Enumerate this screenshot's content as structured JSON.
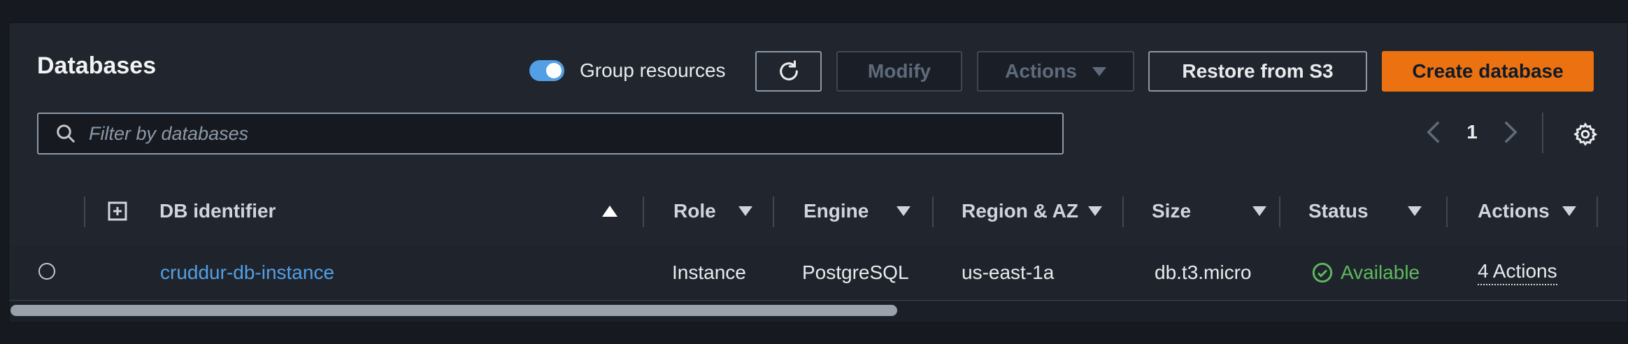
{
  "title": "Databases",
  "toggle": {
    "label": "Group resources",
    "on": true
  },
  "buttons": {
    "modify": "Modify",
    "actions": "Actions",
    "restore": "Restore from S3",
    "create": "Create database"
  },
  "search": {
    "placeholder": "Filter by databases"
  },
  "pagination": {
    "page": "1"
  },
  "table": {
    "columns": [
      "DB identifier",
      "Role",
      "Engine",
      "Region & AZ",
      "Size",
      "Status",
      "Actions"
    ],
    "rows": [
      {
        "db_identifier": "cruddur-db-instance",
        "role": "Instance",
        "engine": "PostgreSQL",
        "region_az": "us-east-1a",
        "size": "db.t3.micro",
        "status": "Available",
        "actions": "4 Actions"
      }
    ]
  },
  "colors": {
    "primary": "#ec7211",
    "link": "#539fe5",
    "status_ok": "#5fb85f",
    "toggle": "#539fe5"
  },
  "icons": [
    "refresh-icon",
    "caret-down-icon",
    "search-icon",
    "chevron-left-icon",
    "chevron-right-icon",
    "gear-icon",
    "expand-icon",
    "sort-up-icon",
    "sort-down-icon",
    "check-circle-icon"
  ]
}
